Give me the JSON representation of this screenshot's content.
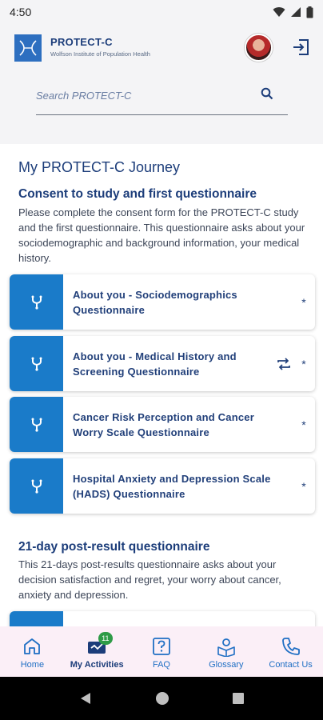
{
  "status_bar": {
    "time": "4:50"
  },
  "header": {
    "brand_name": "PROTECT-C",
    "brand_subtitle": "Wolfson Institute of Population Health"
  },
  "search": {
    "placeholder": "Search PROTECT-C",
    "value": ""
  },
  "journey": {
    "title": "My PROTECT-C Journey",
    "sections": [
      {
        "title": "Consent to study and first questionnaire",
        "description": "Please complete the consent form for the PROTECT-C study and the first questionnaire. This questionnaire asks about your sociodemographic and background information, your medical history.",
        "items": [
          {
            "label": "About you - Sociodemographics Questionnaire",
            "marker": "*",
            "repeat": false
          },
          {
            "label": "About you - Medical History and Screening Questionnaire",
            "marker": "*",
            "repeat": true
          },
          {
            "label": "Cancer Risk Perception and Cancer Worry Scale Questionnaire",
            "marker": "*",
            "repeat": false
          },
          {
            "label": "Hospital Anxiety and Depression Scale (HADS) Questionnaire",
            "marker": "*",
            "repeat": false
          }
        ]
      },
      {
        "title": "21-day post-result questionnaire",
        "description": "This 21-days post-results questionnaire asks about your decision satisfaction and regret, your worry about cancer, anxiety and depression."
      }
    ]
  },
  "bottom_nav": {
    "items": [
      {
        "label": "Home",
        "icon": "home-icon",
        "active": false
      },
      {
        "label": "My Activities",
        "icon": "activities-icon",
        "active": true,
        "badge": "11"
      },
      {
        "label": "FAQ",
        "icon": "faq-icon",
        "active": false
      },
      {
        "label": "Glossary",
        "icon": "glossary-icon",
        "active": false
      },
      {
        "label": "Contact Us",
        "icon": "phone-icon",
        "active": false
      }
    ]
  },
  "colors": {
    "brand_blue": "#1a7bc9",
    "heading_navy": "#1c3d7a",
    "nav_background": "#fbeff7",
    "badge_green": "#2e9b47"
  }
}
